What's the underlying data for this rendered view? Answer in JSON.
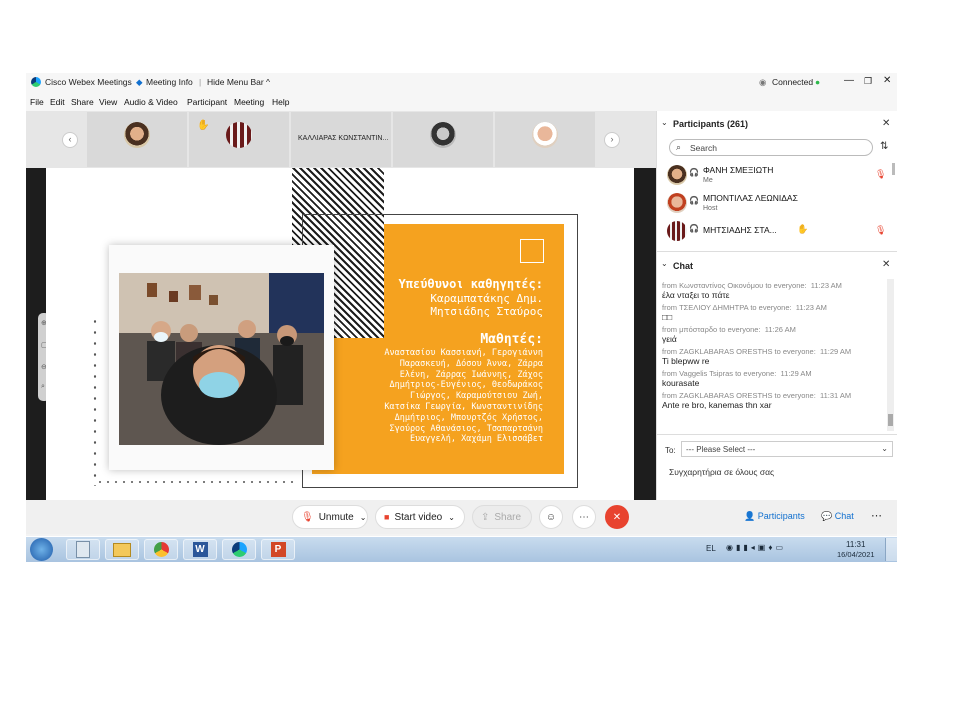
{
  "titlebar": {
    "app_title": "Cisco Webex Meetings",
    "meeting_info": "Meeting Info",
    "hide_menu": "Hide Menu Bar ^",
    "status": "Connected"
  },
  "menu": [
    "File",
    "Edit",
    "Share",
    "View",
    "Audio & Video",
    "Participant",
    "Meeting",
    "Help"
  ],
  "strip": {
    "tile3_name": "ΚΑΛΛΙΑΡΑΣ ΚΩΝΣΤΑΝΤΙΝ..."
  },
  "slide": {
    "heading1": "Υπεύθυνοι καθηγητές:",
    "teachers": [
      "Καραμπατάκης Δημ.",
      "Μητσιάδης Σταύρος"
    ],
    "heading2": "Μαθητές:",
    "students": [
      "Αναστασίου Κασσιανή, Γερογιάννη",
      "Παρασκευή, Δόσου Άννα, Ζάρρα",
      "Ελένη, Ζάρρας Ιωάννης, Ζάχος",
      "Δημήτριος-Ευγένιος, Θεοδωράκος",
      "Γιώργος, Καραμούτσιου Ζωή,",
      "Κατσίκα Γεωργία, Κωνσταντινίδης",
      "Δημήτριος, Μπουρτζός Χρήστος,",
      "Σγούρος Αθανάσιος, Τσαπαρτσάνη",
      "Ευαγγελή, Χαχάμη Ελισσάβετ"
    ]
  },
  "controls": {
    "unmute": "Unmute",
    "start_video": "Start video",
    "share": "Share",
    "participants": "Participants",
    "chat": "Chat"
  },
  "participants": {
    "title": "Participants (261)",
    "search_placeholder": "Search",
    "list": [
      {
        "name": "ΦΑΝΗ ΣΜΕΞΙΩΤΗ",
        "role": "Me"
      },
      {
        "name": "ΜΠΟΝΤΙΛΑΣ ΛΕΩΝΙΔΑΣ",
        "role": "Host"
      },
      {
        "name": "ΜΗΤΣΙΑΔΗΣ ΣΤΑ...",
        "role": ""
      }
    ]
  },
  "chat": {
    "title": "Chat",
    "messages": [
      {
        "from": "from Κωνσταντίνος Οικονόμου to everyone:",
        "time": "11:23 AM",
        "text": "έλα νταξει το πάτε"
      },
      {
        "from": "from ΤΣΕΛΙΟΥ ΔΗΜΗΤΡΑ to everyone:",
        "time": "11:23 AM",
        "text": "□□"
      },
      {
        "from": "from μπόσταρδο to everyone:",
        "time": "11:26 AM",
        "text": "γειά"
      },
      {
        "from": "from ZAGKLABARAS ORESTHS to everyone:",
        "time": "11:29 AM",
        "text": "Ti blepww re"
      },
      {
        "from": "from Vaggelis Tsipras to everyone:",
        "time": "11:29 AM",
        "text": "kourasate"
      },
      {
        "from": "from ZAGKLABARAS ORESTHS to everyone:",
        "time": "11:31 AM",
        "text": "Ante re bro, kanemas thn xar"
      }
    ],
    "to_label": "To:",
    "to_value": "--- Please Select ---",
    "input_text": "Συγχαρητήρια σε όλους σας"
  },
  "taskbar": {
    "lang": "EL",
    "time": "11:31",
    "date": "16/04/2021"
  },
  "colors": {
    "slide_orange": "#f5a21f",
    "end_call_red": "#e8432f",
    "connected_green": "#2db84b",
    "webex_blue": "#1170cf"
  }
}
